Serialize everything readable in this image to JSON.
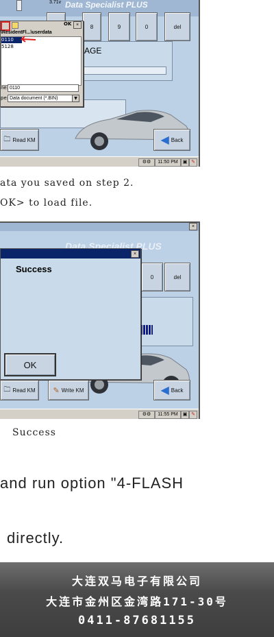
{
  "shot1": {
    "voltage": "3.71v",
    "app_title": "Data Specialist PLUS",
    "keys": [
      "8",
      "9",
      "0",
      "del"
    ],
    "ok_key": "OK",
    "file_dialog": {
      "path": "\\ResidentFl...\\userdata",
      "files": [
        "0110",
        "5128"
      ],
      "name_label": "ne:",
      "name_value": "0110",
      "type_label": "pe:",
      "type_value": "Data document (*.BIN)"
    },
    "panel_text": "AGE",
    "read_km": "Read KM",
    "back": "Back",
    "clock": "11:50 PM"
  },
  "caption1_line1": "ata you saved on step 2.",
  "caption1_line2": "OK> to load file.",
  "shot2": {
    "app_title": "Data Specialist PLUS",
    "keys": [
      "0",
      "del"
    ],
    "dialog_title": "Success",
    "ok": "OK",
    "read_km": "Read KM",
    "write_km": "Write KM",
    "back": "Back",
    "clock": "11:55 PM"
  },
  "caption2": "Success",
  "instruction_line1": "and run option \"4-FLASH",
  "instruction_line2": "directly.",
  "footer": {
    "company": "大连双马电子有限公司",
    "address": "大连市金州区金湾路171-30号",
    "phone": "0411-87681155"
  }
}
